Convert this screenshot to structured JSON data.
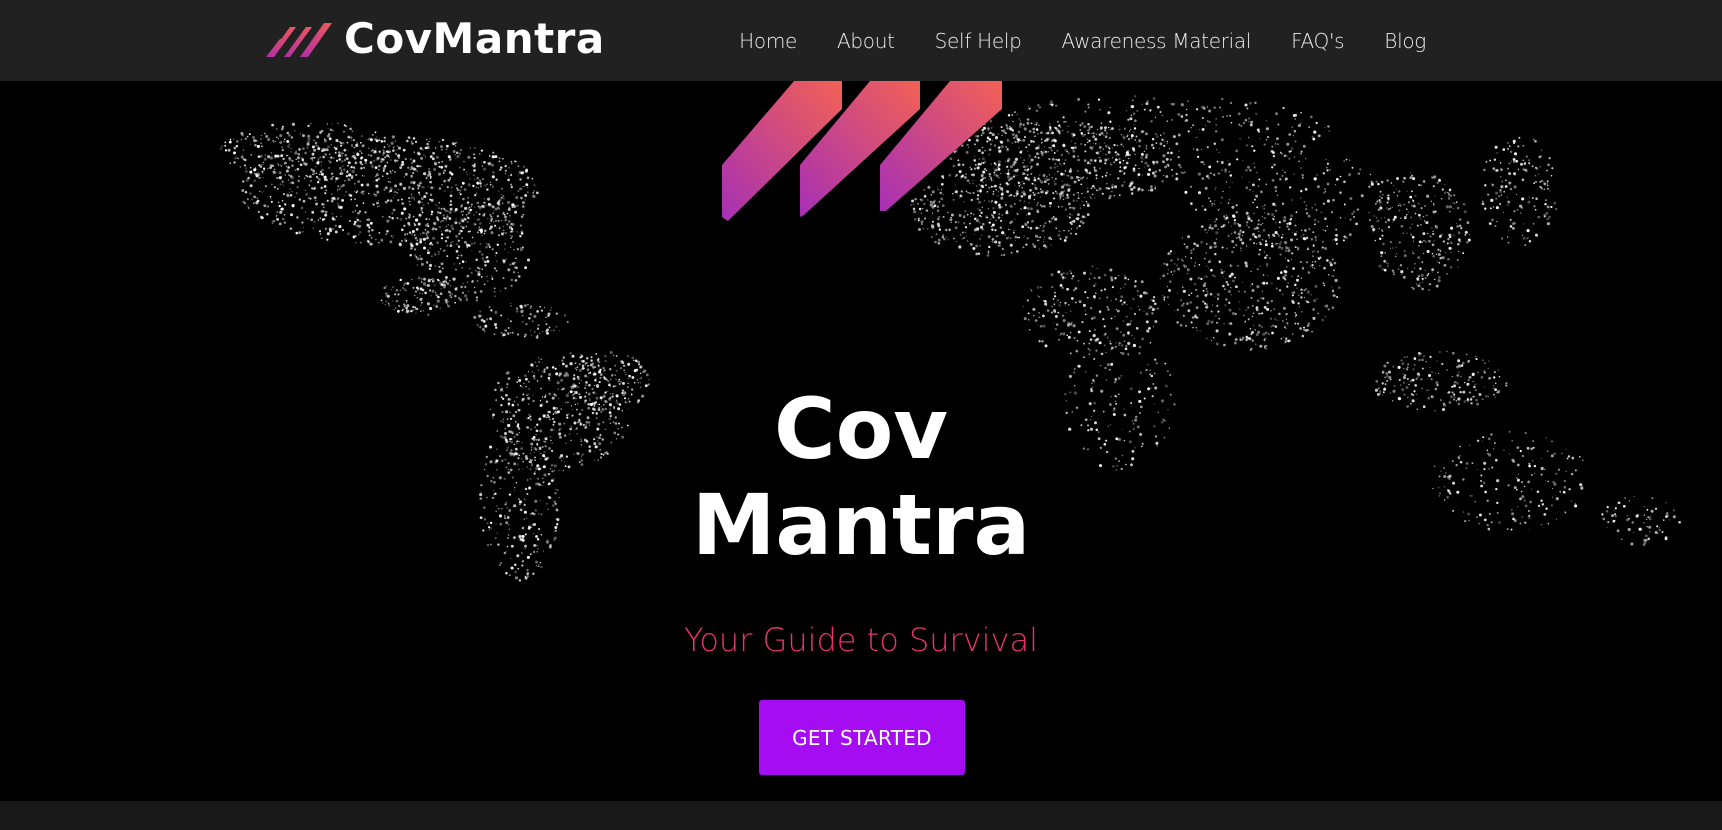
{
  "brand": {
    "name": "CovMantra",
    "logo_icon": "three-stripes-logo-icon"
  },
  "nav": {
    "items": [
      {
        "label": "Home"
      },
      {
        "label": "About"
      },
      {
        "label": "Self Help"
      },
      {
        "label": "Awareness Material"
      },
      {
        "label": "FAQ's"
      },
      {
        "label": "Blog"
      }
    ]
  },
  "hero": {
    "title_line1": "Cov",
    "title_line2": "Mantra",
    "subtitle": "Your Guide to Survival",
    "cta_label": "GET STARTED",
    "background": "world-map-night-lights"
  },
  "colors": {
    "navbar_bg": "#212121",
    "accent_purple": "#a60cf2",
    "subtitle_pink": "#e8336d",
    "gradient_start": "#f05a5a",
    "gradient_end": "#b02ea8"
  }
}
